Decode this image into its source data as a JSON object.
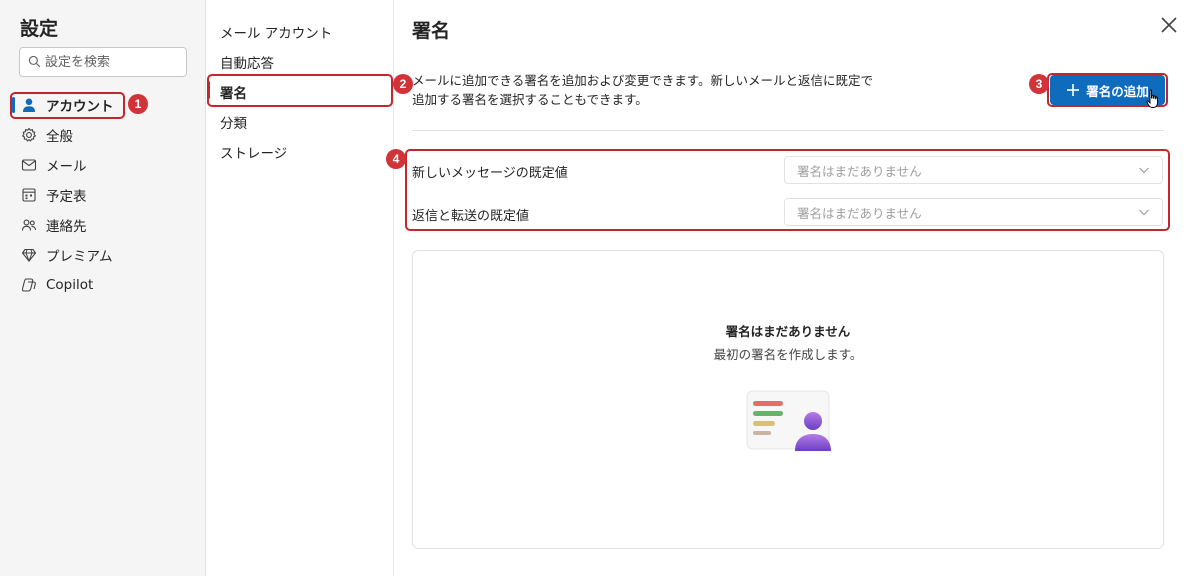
{
  "sidebar": {
    "title": "設定",
    "search_placeholder": "設定を検索",
    "items": [
      {
        "label": "アカウント",
        "icon": "person-icon",
        "active": true
      },
      {
        "label": "全般",
        "icon": "gear-icon"
      },
      {
        "label": "メール",
        "icon": "mail-icon"
      },
      {
        "label": "予定表",
        "icon": "calendar-icon"
      },
      {
        "label": "連絡先",
        "icon": "people-icon"
      },
      {
        "label": "プレミアム",
        "icon": "diamond-icon"
      },
      {
        "label": "Copilot",
        "icon": "copilot-icon"
      }
    ]
  },
  "subnav": {
    "items": [
      {
        "label": "メール アカウント"
      },
      {
        "label": "自動応答"
      },
      {
        "label": "署名",
        "active": true
      },
      {
        "label": "分類"
      },
      {
        "label": "ストレージ"
      }
    ]
  },
  "main": {
    "title": "署名",
    "description": "メールに追加できる署名を追加および変更できます。新しいメールと返信に既定で追加する署名を選択することもできます。",
    "add_button": "署名の追加",
    "defaults": [
      {
        "label": "新しいメッセージの既定値",
        "value": "署名はまだありません"
      },
      {
        "label": "返信と転送の既定値",
        "value": "署名はまだありません"
      }
    ],
    "empty_state": {
      "title": "署名はまだありません",
      "subtitle": "最初の署名を作成します。"
    }
  },
  "callouts": [
    "1",
    "2",
    "3",
    "4"
  ],
  "colors": {
    "accent": "#0f6cbd",
    "highlight": "#c4262e",
    "badge": "#d13438"
  }
}
